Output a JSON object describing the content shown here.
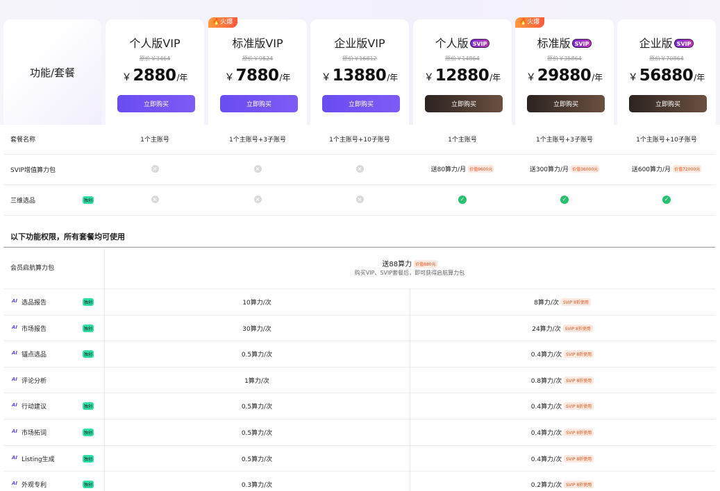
{
  "header": {
    "corner_label": "功能/套餐",
    "plans": [
      {
        "name": "个人版VIP",
        "svip": false,
        "orig": "原价￥3464",
        "currency": "￥",
        "price": "2880",
        "unit": "/年",
        "buy": "立即购买",
        "hot": ""
      },
      {
        "name": "标准版VIP",
        "svip": false,
        "orig": "原价￥9624",
        "currency": "￥",
        "price": "7880",
        "unit": "/年",
        "buy": "立即购买",
        "hot": "火爆"
      },
      {
        "name": "企业版VIP",
        "svip": false,
        "orig": "原价￥16812",
        "currency": "￥",
        "price": "13880",
        "unit": "/年",
        "buy": "立即购买",
        "hot": ""
      },
      {
        "name": "个人版",
        "svip": true,
        "svip_tag": "SVIP",
        "orig": "原价￥14864",
        "currency": "￥",
        "price": "12880",
        "unit": "/年",
        "buy": "立即购买",
        "hot": ""
      },
      {
        "name": "标准版",
        "svip": true,
        "svip_tag": "SVIP",
        "orig": "原价￥35864",
        "currency": "￥",
        "price": "29880",
        "unit": "/年",
        "buy": "立即购买",
        "hot": "火爆"
      },
      {
        "name": "企业版",
        "svip": true,
        "svip_tag": "SVIP",
        "orig": "原价￥70864",
        "currency": "￥",
        "price": "56880",
        "unit": "/年",
        "buy": "立即购买",
        "hot": ""
      }
    ]
  },
  "rows": {
    "package_name": {
      "label": "套餐名称",
      "values": [
        "1个主账号",
        "1个主账号+3子账号",
        "1个主账号+10子账号",
        "1个主账号",
        "1个主账号+3子账号",
        "1个主账号+10子账号"
      ]
    },
    "svip_pack": {
      "label": "SVIP增值算力包",
      "values": [
        "",
        "",
        "",
        "送80算力/月",
        "送300算力/月",
        "送600算力/月"
      ],
      "badges": [
        "",
        "",
        "",
        "价值9600元",
        "价值36000元",
        "价值72000元"
      ]
    },
    "three_dim": {
      "label": "三维选品",
      "badge": "独创",
      "values": [
        "no",
        "no",
        "no",
        "yes",
        "yes",
        "yes"
      ]
    }
  },
  "section": {
    "title": "以下功能权限，所有套餐均可使用"
  },
  "starter": {
    "label": "会员启航算力包",
    "value": "送88算力",
    "badge": "价值880元",
    "note": "购买VIP、SVIP套餐后，即可获得启航算力包"
  },
  "features": [
    {
      "ai": "AI",
      "label": "选品报告",
      "badge": "独创",
      "vip": "10算力/次",
      "svip": "8算力/次",
      "svip_badge": "SVIP 8折使用"
    },
    {
      "ai": "AI",
      "label": "市场报告",
      "badge": "独创",
      "vip": "30算力/次",
      "svip": "24算力/次",
      "svip_badge": "SVIP 8折使用"
    },
    {
      "ai": "AI",
      "label": "锚点选品",
      "badge": "独创",
      "vip": "0.5算力/次",
      "svip": "0.4算力/次",
      "svip_badge": "SVIP 8折使用"
    },
    {
      "ai": "AI",
      "label": "评论分析",
      "badge": "",
      "vip": "1算力/次",
      "svip": "0.8算力/次",
      "svip_badge": "SVIP 8折使用"
    },
    {
      "ai": "AI",
      "label": "行动建议",
      "badge": "独创",
      "vip": "0.5算力/次",
      "svip": "0.4算力/次",
      "svip_badge": "SVIP 8折使用"
    },
    {
      "ai": "AI",
      "label": "市场拓词",
      "badge": "独创",
      "vip": "0.5算力/次",
      "svip": "0.4算力/次",
      "svip_badge": "SVIP 8折使用"
    },
    {
      "ai": "AI",
      "label": "Listing生成",
      "badge": "独创",
      "vip": "0.5算力/次",
      "svip": "0.4算力/次",
      "svip_badge": "SVIP 8折使用"
    },
    {
      "ai": "AI",
      "label": "外观专利",
      "badge": "独创",
      "vip": "0.3算力/次",
      "svip": "0.2算力/次",
      "svip_badge": "SVIP 8折使用"
    }
  ],
  "colors": {
    "vip_button": "#6a4cf2",
    "svip_button": "#3a2c26",
    "ok": "#25c16f",
    "badge_green": "#2fe0a8",
    "accent_orange": "#e8541c"
  }
}
